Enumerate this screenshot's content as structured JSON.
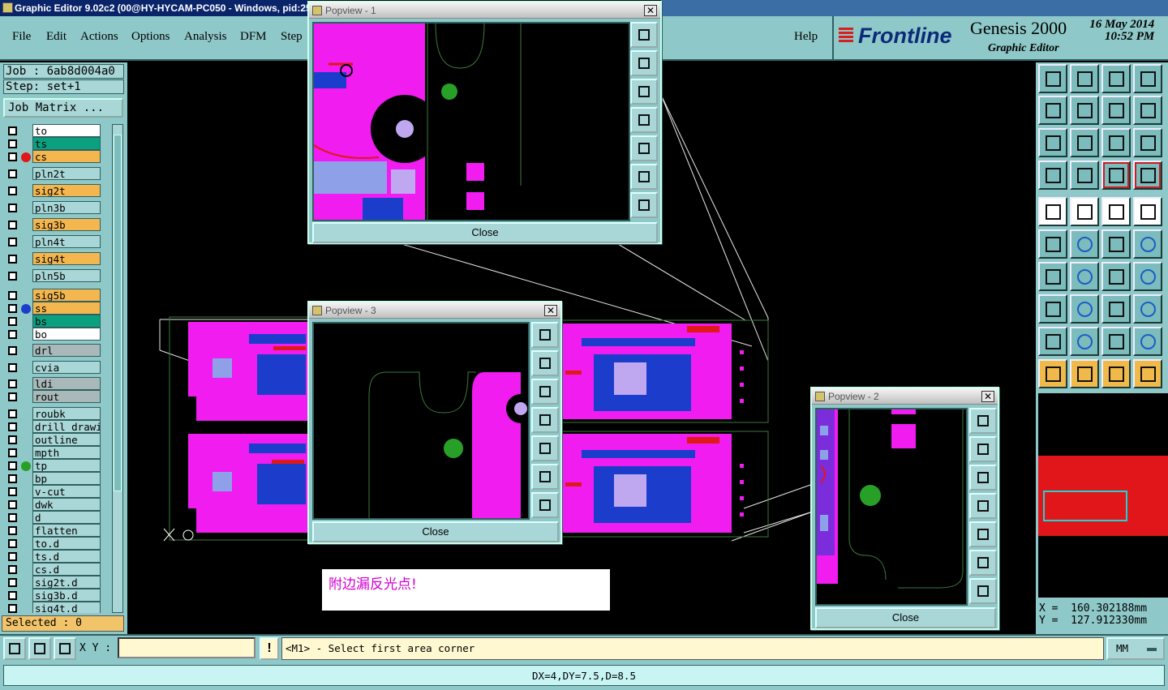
{
  "window": {
    "title": "Graphic Editor 9.02c2 (00@HY-HYCAM-PC050 - Windows, pid:259"
  },
  "menu": {
    "items": [
      "File",
      "Edit",
      "Actions",
      "Options",
      "Analysis",
      "DFM",
      "Step"
    ],
    "help": "Help"
  },
  "brand": {
    "company": "Frontline",
    "product": "Genesis 2000",
    "subtitle": "Graphic Editor",
    "date": "16 May 2014",
    "time": "10:52 PM"
  },
  "job": {
    "job_label": "Job : 6ab8d004a0",
    "step_label": "Step: set+1",
    "job_matrix": "Job Matrix ..."
  },
  "layers": [
    {
      "name": "to",
      "color": "#ffffff",
      "dot": ""
    },
    {
      "name": "ts",
      "color": "#0aa080",
      "dot": ""
    },
    {
      "name": "cs",
      "color": "#f4b64e",
      "dot": "#e01818"
    },
    {
      "name": "pln2t",
      "color": "#a9d6d6",
      "dot": ""
    },
    {
      "name": "sig2t",
      "color": "#f4b64e",
      "dot": ""
    },
    {
      "name": "pln3b",
      "color": "#a9d6d6",
      "dot": ""
    },
    {
      "name": "sig3b",
      "color": "#f4b64e",
      "dot": ""
    },
    {
      "name": "pln4t",
      "color": "#a9d6d6",
      "dot": ""
    },
    {
      "name": "sig4t",
      "color": "#f4b64e",
      "dot": ""
    },
    {
      "name": "pln5b",
      "color": "#a9d6d6",
      "dot": ""
    },
    {
      "name": "sig5b",
      "color": "#f4b64e",
      "dot": ""
    },
    {
      "name": "ss",
      "color": "#f4b64e",
      "dot": "#1c3ccc"
    },
    {
      "name": "bs",
      "color": "#0aa080",
      "dot": ""
    },
    {
      "name": "bo",
      "color": "#ffffff",
      "dot": ""
    },
    {
      "name": "drl",
      "color": "#a9b8b8",
      "dot": ""
    },
    {
      "name": "cvia",
      "color": "#a9d6d6",
      "dot": ""
    },
    {
      "name": "ldi",
      "color": "#a9b8b8",
      "dot": ""
    },
    {
      "name": "rout",
      "color": "#a9b8b8",
      "dot": ""
    },
    {
      "name": "roubk",
      "color": "#a9d6d6",
      "dot": ""
    },
    {
      "name": "drill_drawin",
      "color": "#a9d6d6",
      "dot": ""
    },
    {
      "name": "outline",
      "color": "#a9d6d6",
      "dot": ""
    },
    {
      "name": "mpth",
      "color": "#a9d6d6",
      "dot": ""
    },
    {
      "name": "tp",
      "color": "#a9d6d6",
      "dot": "#28a028"
    },
    {
      "name": "bp",
      "color": "#a9d6d6",
      "dot": ""
    },
    {
      "name": "v-cut",
      "color": "#a9d6d6",
      "dot": ""
    },
    {
      "name": "dwk",
      "color": "#a9d6d6",
      "dot": ""
    },
    {
      "name": "d",
      "color": "#a9d6d6",
      "dot": ""
    },
    {
      "name": "flatten",
      "color": "#a9d6d6",
      "dot": ""
    },
    {
      "name": "to.d",
      "color": "#a9d6d6",
      "dot": ""
    },
    {
      "name": "ts.d",
      "color": "#a9d6d6",
      "dot": ""
    },
    {
      "name": "cs.d",
      "color": "#a9d6d6",
      "dot": ""
    },
    {
      "name": "sig2t.d",
      "color": "#a9d6d6",
      "dot": ""
    },
    {
      "name": "sig3b.d",
      "color": "#a9d6d6",
      "dot": ""
    },
    {
      "name": "sig4t.d",
      "color": "#a9d6d6",
      "dot": ""
    }
  ],
  "selected": "Selected : 0",
  "popups": [
    {
      "title": "Popview - 1",
      "close": "Close"
    },
    {
      "title": "Popview - 3",
      "close": "Close"
    },
    {
      "title": "Popview - 2",
      "close": "Close"
    }
  ],
  "note": "附边漏反光点!",
  "coords": {
    "x": "X =  160.302188mm",
    "y": "Y =  127.912330mm"
  },
  "bottom": {
    "xy_label": "X Y :",
    "xy_value": "",
    "warn": "!",
    "prompt": "<M1> - Select first area corner",
    "units": "MM"
  },
  "status": "DX=4,DY=7.5,D=8.5",
  "colors": {
    "panel": "#8fc8c8",
    "accent": "#ff00ff",
    "copper": "#e81010",
    "background": "#000000"
  }
}
